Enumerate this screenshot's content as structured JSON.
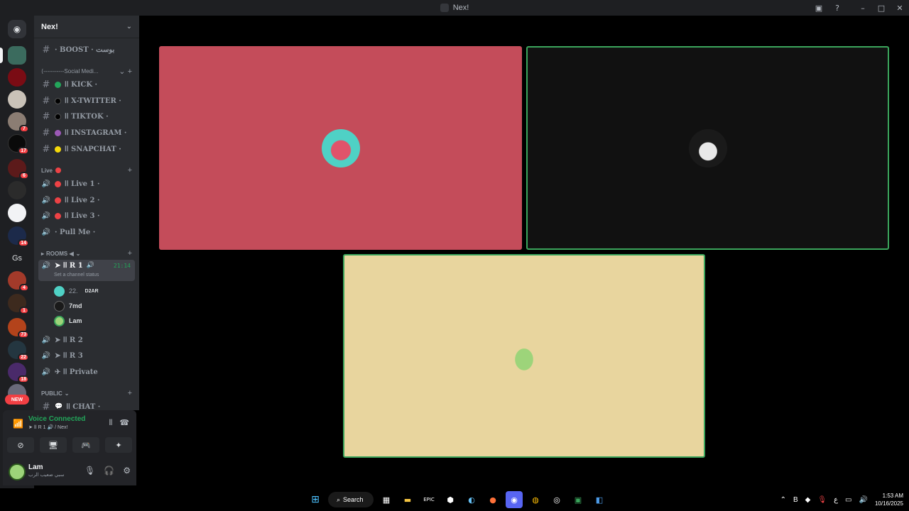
{
  "window": {
    "title": "Nex!"
  },
  "rail": {
    "new_label": "NEW",
    "badges": [
      "7",
      "17",
      "6",
      "14",
      "4",
      "1",
      "73",
      "22",
      "18"
    ],
    "text_server": "Gs"
  },
  "server": {
    "name": "Nex!"
  },
  "channels": {
    "boost": "· BOOST · بوست",
    "social_category": "⟨-----------Social Medi...",
    "kick": "اا KICK ·",
    "xtwitter": "اا X-TWITTER ·",
    "tiktok": "اا TIKTOK ·",
    "instagram": "اا INSTAGRAM ·",
    "snapchat": "اا SNAPCHAT ·",
    "live_category": "Live",
    "live1": "اا Live 1 ·",
    "live2": "اا Live 2 ·",
    "live3": "اا Live 3 ·",
    "pullme": "· Pull Me ·",
    "rooms_category": "ROOMS ◀",
    "r1": "➤ اا R 1",
    "r1_time": "21:14",
    "r1_status": "Set a channel status",
    "r2": "➤ اا R 2",
    "r3": "➤ اا R 3",
    "private": "✈ اا Private",
    "public_category": "PUBLIC",
    "chat": "اا CHAT ·"
  },
  "voice_users": [
    {
      "name": "22.",
      "tag": "D2AR"
    },
    {
      "name": "7md",
      "tag": ""
    },
    {
      "name": "Lam",
      "tag": ""
    }
  ],
  "voice_panel": {
    "status": "Voice Connected",
    "channel": "➤ اا R 1 🔊 / Nex!"
  },
  "user_panel": {
    "name": "Lam",
    "status": "سبي ضعيب الرب"
  },
  "taskbar": {
    "search_label": "Search",
    "time": "1:53 AM",
    "date": "10/16/2025",
    "lang": "ع"
  },
  "colors": {
    "tile1": "#c44c5a",
    "tile2": "#111111",
    "tile3": "#e8d59e",
    "speaking": "#3ba55c",
    "kick": "#53fc18",
    "xtwitter": "#000000",
    "tiktok": "#000000",
    "instagram": "#9b59b6",
    "snapchat": "#f5d90a",
    "live": "#ed4245"
  }
}
